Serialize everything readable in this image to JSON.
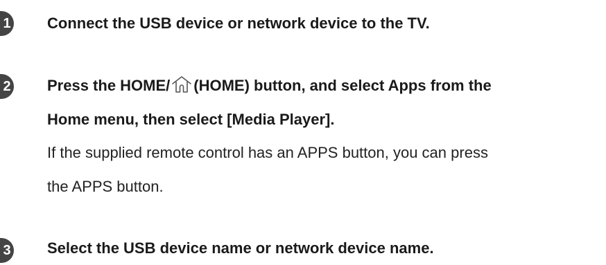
{
  "steps": [
    {
      "number": "1",
      "title": "Connect the USB device or network device to the TV."
    },
    {
      "number": "2",
      "title_part1": "Press the HOME/",
      "title_part2": "(HOME) button, and select Apps from the",
      "title_line2": "Home menu, then select [Media Player].",
      "note_line1": "If the supplied remote control has an APPS button, you can press",
      "note_line2": "the APPS button.",
      "icon": "home-icon"
    },
    {
      "number": "3",
      "title": "Select the USB device name or network device name."
    }
  ],
  "colors": {
    "badge": "#444444",
    "text": "#1a1a1a"
  }
}
